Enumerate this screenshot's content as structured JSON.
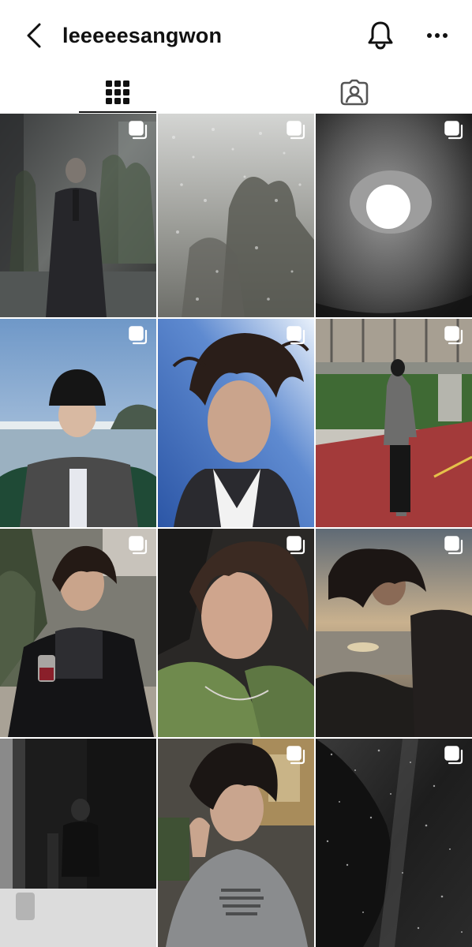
{
  "header": {
    "username": "leeeeesangwon",
    "icons": {
      "back": "chevron-left-icon",
      "bell": "bell-icon",
      "more": "more-horizontal-icon"
    }
  },
  "tabs": [
    {
      "name": "posts-grid",
      "icon": "grid-icon",
      "active": true
    },
    {
      "name": "tagged",
      "icon": "tagged-person-icon",
      "active": false
    }
  ],
  "posts": [
    {
      "index": 1,
      "description_icon": "carousel-icon",
      "tone": "dark-reflection-portrait"
    },
    {
      "index": 2,
      "description_icon": "carousel-icon",
      "tone": "rainy-window-grey"
    },
    {
      "index": 3,
      "description_icon": "carousel-icon",
      "tone": "grey-light-circle"
    },
    {
      "index": 4,
      "description_icon": "carousel-icon",
      "tone": "blue-sky-beanie"
    },
    {
      "index": 5,
      "description_icon": "carousel-icon",
      "tone": "blue-sky-windswept"
    },
    {
      "index": 6,
      "description_icon": "carousel-icon",
      "tone": "red-track-bridge"
    },
    {
      "index": 7,
      "description_icon": "carousel-icon",
      "tone": "garden-wine-glass"
    },
    {
      "index": 8,
      "description_icon": "carousel-icon",
      "tone": "green-shirt-selfie"
    },
    {
      "index": 9,
      "description_icon": "carousel-icon",
      "tone": "sunset-sea"
    },
    {
      "index": 10,
      "description_icon": "",
      "tone": "black-white-room"
    },
    {
      "index": 11,
      "description_icon": "carousel-icon",
      "tone": "grey-tshirt-night"
    },
    {
      "index": 12,
      "description_icon": "carousel-icon",
      "tone": "dark-speckled-window"
    }
  ],
  "colors": {
    "text": "#111111",
    "background": "#ffffff",
    "accent_track": "#a33a3a"
  }
}
